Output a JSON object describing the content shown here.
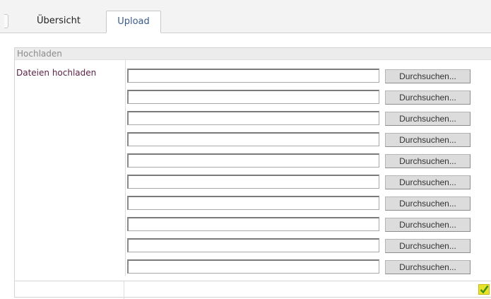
{
  "tabs": [
    {
      "label": "Übersicht",
      "active": false
    },
    {
      "label": "Upload",
      "active": true
    }
  ],
  "panel": {
    "header": "Hochladen",
    "field_label": "Dateien hochladen",
    "file_rows": [
      {
        "value": "",
        "button_label": "Durchsuchen..."
      },
      {
        "value": "",
        "button_label": "Durchsuchen..."
      },
      {
        "value": "",
        "button_label": "Durchsuchen..."
      },
      {
        "value": "",
        "button_label": "Durchsuchen..."
      },
      {
        "value": "",
        "button_label": "Durchsuchen..."
      },
      {
        "value": "",
        "button_label": "Durchsuchen..."
      },
      {
        "value": "",
        "button_label": "Durchsuchen..."
      },
      {
        "value": "",
        "button_label": "Durchsuchen..."
      },
      {
        "value": "",
        "button_label": "Durchsuchen..."
      },
      {
        "value": "",
        "button_label": "Durchsuchen..."
      }
    ]
  },
  "submit": {
    "icon": "checkmark-icon",
    "color": "#e9e22a"
  }
}
